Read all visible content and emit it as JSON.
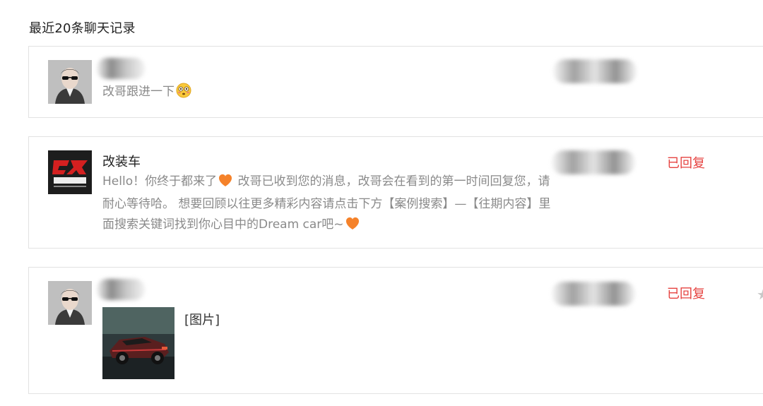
{
  "header": {
    "title": "最近20条聊天记录"
  },
  "colors": {
    "replied": "#e64340",
    "message_text": "#8a8a8a",
    "border": "#e2e2e2"
  },
  "messages": [
    {
      "sender": "",
      "sender_redacted": true,
      "avatar": "user-avatar-photo",
      "text": "改哥跟进一下",
      "emoji": "flushed-face-icon",
      "time_redacted": true,
      "status": ""
    },
    {
      "sender": "改装车",
      "avatar": "gaizhuangche-logo",
      "text_parts": [
        "Hello！你终于都来了",
        " 改哥已收到您的消息，改哥会在看到的第一时间回复您，请耐心等待哈。 想要回顾以往更多精彩内容请点击下方【案例搜索】—【往期内容】里面搜索关键词找到你心目中的Dream car吧~"
      ],
      "emoji": "orange-heart-icon",
      "time_redacted": true,
      "status": "已回复"
    },
    {
      "sender": "",
      "sender_redacted": true,
      "avatar": "user-avatar-photo",
      "image_label": "[图片]",
      "image": "car-photo-thumbnail",
      "time_redacted": true,
      "status": "已回复",
      "action_icon": "star-icon"
    }
  ]
}
